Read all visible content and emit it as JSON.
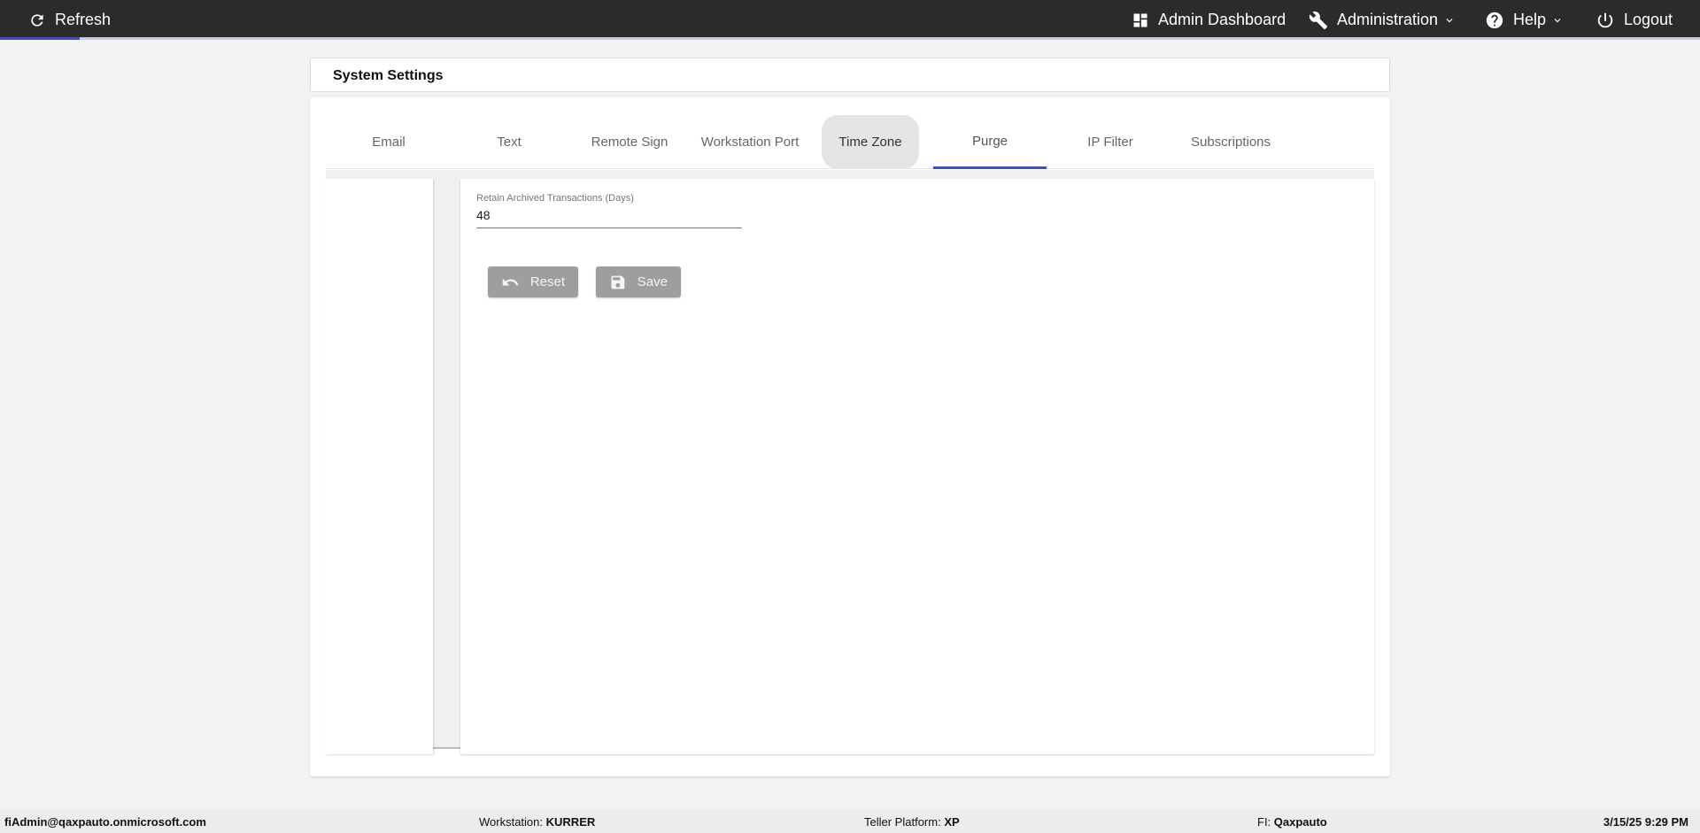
{
  "topbar": {
    "refresh_label": "Refresh",
    "admin_dashboard_label": "Admin Dashboard",
    "administration_label": "Administration",
    "help_label": "Help",
    "logout_label": "Logout",
    "progress_fraction": 0.047
  },
  "page": {
    "title": "System Settings"
  },
  "tabs": [
    {
      "label": "Email"
    },
    {
      "label": "Text"
    },
    {
      "label": "Remote Sign"
    },
    {
      "label": "Workstation Port"
    },
    {
      "label": "Time Zone"
    },
    {
      "label": "Purge"
    },
    {
      "label": "IP Filter"
    },
    {
      "label": "Subscriptions"
    }
  ],
  "active_tab": "Purge",
  "form": {
    "retain_label": "Retain Archived Transactions (Days)",
    "retain_value": "48",
    "reset_label": "Reset",
    "save_label": "Save"
  },
  "footer": {
    "user": "fiAdmin@qaxpauto.onmicrosoft.com",
    "workstation_label": "Workstation:",
    "workstation_value": "KURRER",
    "teller_label": "Teller Platform:",
    "teller_value": "XP",
    "fi_label": "FI:",
    "fi_value": "Qaxpauto",
    "datetime": "3/15/25 9:29 PM"
  },
  "colors": {
    "topbar_bg": "#2b2b2b",
    "accent": "#3f51b5",
    "button_disabled": "#9e9e9e"
  }
}
